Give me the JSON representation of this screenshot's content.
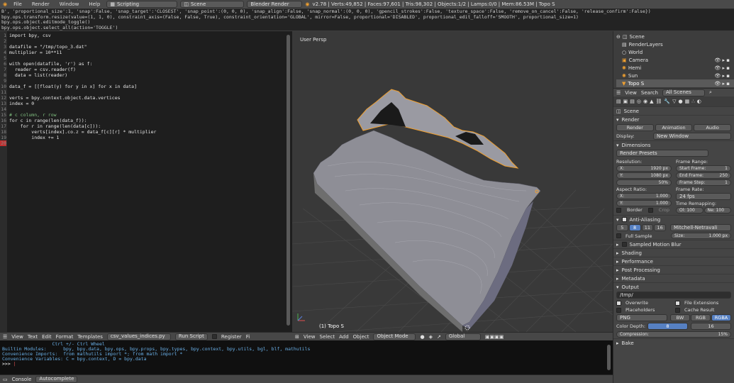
{
  "menu": {
    "items": [
      "File",
      "Render",
      "Window",
      "Help"
    ],
    "screen": "Scripting",
    "scene": "Scene",
    "engine": "Blender Render",
    "stats": "v2.78 | Verts:49,852 | Faces:97,601 | Tris:98,302 | Objects:1/2 | Lamps:0/0 | Mem:86.53M | Topo S"
  },
  "info_log": [
    "B', 'proportional_size':1, 'snap':False, 'snap_target':'CLOSEST', 'snap_point':(0, 0, 0), 'snap_align':False, 'snap_normal':(0, 0, 0), 'gpencil_strokes':False, 'texture_space':False, 'remove_on_cancel':False, 'release_confirm':False})",
    "bpy.ops.transform.resize(value=(1, 1, 0), constraint_axis=(False, False, True), constraint_orientation='GLOBAL', mirror=False, proportional='DISABLED', proportional_edit_falloff='SMOOTH', proportional_size=1)",
    "bpy.ops.object.editmode_toggle()",
    "bpy.ops.object.select_all(action='TOGGLE')"
  ],
  "editor": {
    "line_numbers": [
      "1",
      "2",
      "3",
      "4",
      "5",
      "6",
      "7",
      "8",
      "9",
      "10",
      "11",
      "12",
      "13",
      "14",
      "15",
      "16",
      "17",
      "18",
      "19",
      "20"
    ],
    "code_lines": [
      "import bpy, csv",
      "",
      "datafile = \"/tmp/topo_3.dat\"",
      "multiplier = 10**11",
      "",
      "with open(datafile, 'r') as f:",
      "  reader = csv.reader(f)",
      "  data = list(reader)",
      "",
      "data_f = [[float(y) for y in x] for x in data]",
      "",
      "verts = bpy.context.object.data.vertices",
      "index = 0",
      "",
      "# c column, r row",
      "for c in range(len(data_f)):",
      "    for r in range(len(data[c])):",
      "        verts[index].co.z = data_f[c][r] * multiplier",
      "        index += 1",
      ""
    ],
    "header": {
      "view": "View",
      "text": "Text",
      "edit": "Edit",
      "format": "Format",
      "templates": "Templates",
      "filename": "csv_values_indices.py",
      "run": "Run Script",
      "register": "Register",
      "fi": "Fi"
    }
  },
  "viewport": {
    "label": "User Persp",
    "object_label": "(1) Topo S",
    "header": {
      "view": "View",
      "select": "Select",
      "add": "Add",
      "object": "Object",
      "mode": "Object Mode",
      "orientation": "Global"
    }
  },
  "console": {
    "lines": [
      "                  Ctrl +/- Ctrl Wheel",
      "Builtin Modules:      bpy, bpy.data, bpy.ops, bpy.props, bpy.types, bpy.context, bpy.utils, bgl, blf, mathutils",
      "Convenience Imports:  from mathutils import *; from math import *",
      "Convenience Variables: C = bpy.context, D = bpy.data"
    ],
    "prompt": ">>> ",
    "tabs": [
      "Console",
      "Autocomplete"
    ]
  },
  "outliner": {
    "items": [
      "Scene",
      "RenderLayers",
      "World",
      "Camera",
      "Hemi",
      "Sun",
      "Topo S"
    ],
    "header": {
      "view": "View",
      "search": "Search",
      "filter": "All Scenes"
    }
  },
  "props": {
    "breadcrumb": "Scene",
    "render_section": "Render",
    "render_btn": "Render",
    "animation_btn": "Animation",
    "audio_btn": "Audio",
    "display_label": "Display:",
    "display_value": "New Window",
    "dimensions": "Dimensions",
    "presets": "Render Presets",
    "resolution": "Resolution:",
    "res_x": "X:",
    "res_x_val": "1920 px",
    "res_y": "Y:",
    "res_y_val": "1080 px",
    "res_pct": "50%",
    "frame_range": "Frame Range:",
    "start_frame": "Start Frame:",
    "start_val": "1",
    "end_frame": "End Frame:",
    "end_val": "250",
    "frame_step": "Frame Step:",
    "step_val": "1",
    "aspect": "Aspect Ratio:",
    "asp_x": "X:",
    "asp_x_val": "1.000",
    "asp_y": "Y:",
    "asp_y_val": "1.000",
    "frame_rate": "Frame Rate:",
    "fps": "24 fps",
    "time_remap": "Time Remapping:",
    "old": "Ol: 100",
    "new": "Ne: 100",
    "border": "Border",
    "crop": "Crop",
    "aa": "Anti-Aliasing",
    "aa_samples": [
      "5",
      "8",
      "11",
      "16"
    ],
    "filter": "Mitchell-Netravali",
    "full_sample": "Full Sample",
    "size": "Size:",
    "size_val": "1.000 px",
    "motion_blur": "Sampled Motion Blur",
    "shading": "Shading",
    "performance": "Performance",
    "post": "Post Processing",
    "metadata": "Metadata",
    "output": "Output",
    "out_path": "/tmp/",
    "overwrite": "Overwrite",
    "file_ext": "File Extensions",
    "placeholders": "Placeholders",
    "cache": "Cache Result",
    "format": "PNG",
    "bw": "BW",
    "rgb": "RGB",
    "rgba": "RGBA",
    "color_depth": "Color Depth:",
    "depth8": "8",
    "depth16": "16",
    "compression": "Compression:",
    "comp_val": "15%",
    "bake": "Bake"
  },
  "colors": {
    "accent": "#5680c2",
    "selection": "#f0a030"
  }
}
